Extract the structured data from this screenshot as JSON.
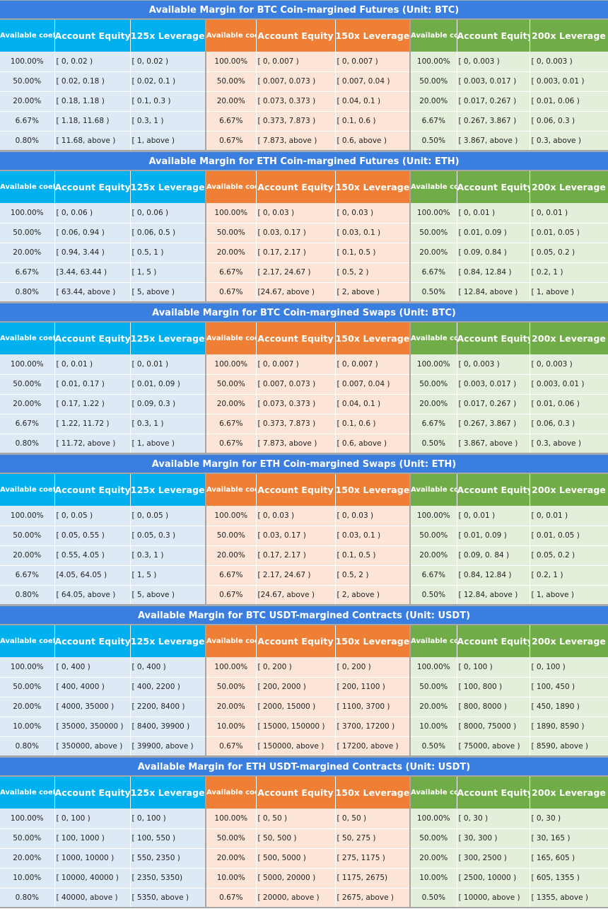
{
  "colors": {
    "title_bg": "#3a7ee0",
    "group_125x": "#00b0ef",
    "group_150x": "#ef7f34",
    "group_200x": "#70ac47",
    "row_125x": "#dde9f5",
    "row_150x": "#fce4d6",
    "row_200x": "#e3efda"
  },
  "headers": {
    "coefficient": "Available coefficient",
    "equity": "Account Equity",
    "lev125": "125x Leverage",
    "lev150": "150x Leverage",
    "lev200": "200x Leverage"
  },
  "tables": [
    {
      "title": "Available Margin for BTC Coin-margined Futures (Unit: BTC)",
      "rows": [
        [
          "100.00%",
          "[ 0, 0.02 )",
          "[ 0, 0.02 )",
          "100.00%",
          "[ 0, 0.007 )",
          "[ 0, 0.007 )",
          "100.00%",
          "[ 0, 0.003 )",
          "[ 0, 0.003 )"
        ],
        [
          "50.00%",
          "[ 0.02, 0.18 )",
          "[ 0.02, 0.1 )",
          "50.00%",
          "[ 0.007, 0.073 )",
          "[ 0.007, 0.04 )",
          "50.00%",
          "[ 0.003, 0.017 )",
          "[ 0.003, 0.01 )"
        ],
        [
          "20.00%",
          "[ 0.18, 1.18 )",
          "[ 0.1, 0.3 )",
          "20.00%",
          "[ 0.073,  0.373 )",
          "[ 0.04, 0.1 )",
          "20.00%",
          "[ 0.017, 0.267 )",
          "[ 0.01, 0.06 )"
        ],
        [
          "6.67%",
          "[ 1.18, 11.68 )",
          "[ 0.3, 1 )",
          "6.67%",
          "[ 0.373, 7.873 )",
          "[ 0.1, 0.6 )",
          "6.67%",
          "[ 0.267, 3.867 )",
          "[ 0.06, 0.3 )"
        ],
        [
          "0.80%",
          "[ 11.68, above )",
          "[ 1, above )",
          "0.67%",
          "[ 7.873, above )",
          "[ 0.6, above )",
          "0.50%",
          "[ 3.867, above )",
          "[ 0.3, above )"
        ]
      ]
    },
    {
      "title": "Available Margin for ETH Coin-margined Futures (Unit: ETH)",
      "rows": [
        [
          "100.00%",
          "[ 0, 0.06 )",
          "[ 0, 0.06 )",
          "100.00%",
          "[ 0, 0.03 )",
          "[ 0, 0.03 )",
          "100.00%",
          "[ 0, 0.01 )",
          "[ 0, 0.01 )"
        ],
        [
          "50.00%",
          "[ 0.06, 0.94 )",
          "[ 0.06, 0.5 )",
          "50.00%",
          "[ 0.03, 0.17 )",
          "[ 0.03, 0.1 )",
          "50.00%",
          "[ 0.01, 0.09 )",
          "[ 0.01, 0.05 )"
        ],
        [
          "20.00%",
          "[ 0.94, 3.44 )",
          "[ 0.5, 1 )",
          "20.00%",
          "[ 0.17, 2.17 )",
          "[ 0.1, 0.5 )",
          "20.00%",
          "[ 0.09, 0.84 )",
          "[ 0.05, 0.2 )"
        ],
        [
          "6.67%",
          "[3.44, 63.44 )",
          "[ 1, 5 )",
          "6.67%",
          "[ 2.17, 24.67 )",
          "[ 0.5, 2 )",
          "6.67%",
          "[ 0.84, 12.84 )",
          "[ 0.2, 1 )"
        ],
        [
          "0.80%",
          "[ 63.44, above )",
          "[ 5, above )",
          "0.67%",
          "[24.67, above )",
          "[ 2, above )",
          "0.50%",
          "[ 12.84, above )",
          "[ 1, above )"
        ]
      ]
    },
    {
      "title": "Available Margin for BTC Coin-margined Swaps (Unit: BTC)",
      "rows": [
        [
          "100.00%",
          "[ 0, 0.01 )",
          "[ 0, 0.01 )",
          "100.00%",
          "[ 0, 0.007 )",
          "[ 0, 0.007 )",
          "100.00%",
          "[ 0, 0.003 )",
          "[ 0, 0.003 )"
        ],
        [
          "50.00%",
          "[ 0.01, 0.17 )",
          "[ 0.01, 0.09 )",
          "50.00%",
          "[ 0.007, 0.073 )",
          "[ 0.007, 0.04 )",
          "50.00%",
          "[ 0.003, 0.017 )",
          "[ 0.003, 0.01 )"
        ],
        [
          "20.00%",
          "[ 0.17, 1.22 )",
          "[ 0.09, 0.3 )",
          "20.00%",
          "[ 0.073,  0.373 )",
          "[ 0.04, 0.1 )",
          "20.00%",
          "[ 0.017, 0.267 )",
          "[ 0.01, 0.06 )"
        ],
        [
          "6.67%",
          "[ 1.22, 11.72 )",
          "[ 0.3, 1 )",
          "6.67%",
          "[ 0.373, 7.873 )",
          "[ 0.1, 0.6 )",
          "6.67%",
          "[ 0.267, 3.867 )",
          "[ 0.06, 0.3 )"
        ],
        [
          "0.80%",
          "[ 11.72, above )",
          "[ 1, above )",
          "0.67%",
          "[ 7.873, above )",
          "[ 0.6, above )",
          "0.50%",
          "[ 3.867, above )",
          "[ 0.3, above )"
        ]
      ]
    },
    {
      "title": "Available Margin for ETH Coin-margined Swaps (Unit: ETH)",
      "rows": [
        [
          "100.00%",
          "[ 0, 0.05 )",
          "[ 0, 0.05 )",
          "100.00%",
          "[ 0, 0.03 )",
          "[ 0, 0.03 )",
          "100.00%",
          "[ 0, 0.01 )",
          "[ 0, 0.01 )"
        ],
        [
          "50.00%",
          "[ 0.05, 0.55 )",
          "[ 0.05, 0.3 )",
          "50.00%",
          "[ 0.03, 0.17 )",
          "[ 0.03, 0.1 )",
          "50.00%",
          "[ 0.01, 0.09 )",
          "[ 0.01, 0.05 )"
        ],
        [
          "20.00%",
          "[ 0.55, 4.05 )",
          "[ 0.3, 1 )",
          "20.00%",
          "[ 0.17, 2.17 )",
          "[ 0.1, 0.5 )",
          "20.00%",
          "[ 0.09, 0. 84 )",
          "[ 0.05, 0.2 )"
        ],
        [
          "6.67%",
          "[4.05, 64.05 )",
          "[ 1, 5 )",
          "6.67%",
          "[ 2.17, 24.67 )",
          "[ 0.5, 2 )",
          "6.67%",
          "[ 0.84, 12.84 )",
          "[ 0.2, 1 )"
        ],
        [
          "0.80%",
          "[ 64.05, above )",
          "[ 5, above )",
          "0.67%",
          "[24.67, above )",
          "[ 2, above )",
          "0.50%",
          "[ 12.84, above )",
          "[ 1, above )"
        ]
      ]
    },
    {
      "title": "Available Margin for BTC USDT-margined Contracts (Unit: USDT)",
      "rows": [
        [
          "100.00%",
          "[ 0, 400 )",
          "[ 0, 400 )",
          "100.00%",
          "[ 0, 200 )",
          "[ 0, 200 )",
          "100.00%",
          "[ 0, 100 )",
          "[ 0, 100 )"
        ],
        [
          "50.00%",
          "[ 400, 4000 )",
          "[ 400, 2200 )",
          "50.00%",
          "[ 200, 2000 )",
          "[ 200, 1100 )",
          "50.00%",
          "[ 100, 800 )",
          "[ 100, 450 )"
        ],
        [
          "20.00%",
          "[ 4000, 35000 )",
          "[ 2200, 8400 )",
          "20.00%",
          "[ 2000,  15000 )",
          "[ 1100, 3700 )",
          "20.00%",
          "[ 800, 8000 )",
          "[ 450, 1890 )"
        ],
        [
          "10.00%",
          "[ 35000, 350000 )",
          "[ 8400, 39900 )",
          "10.00%",
          "[ 15000, 150000 )",
          "[ 3700, 17200 )",
          "10.00%",
          "[ 8000, 75000 )",
          "[ 1890, 8590 )"
        ],
        [
          "0.80%",
          "[ 350000, above )",
          "[ 39900, above )",
          "0.67%",
          "[ 150000, above )",
          "[ 17200, above )",
          "0.50%",
          "[ 75000, above )",
          "[ 8590, above )"
        ]
      ]
    },
    {
      "title": "Available Margin for ETH USDT-margined Contracts (Unit: USDT)",
      "rows": [
        [
          "100.00%",
          "[ 0, 100 )",
          "[ 0, 100 )",
          "100.00%",
          "[ 0, 50 )",
          "[ 0, 50 )",
          "100.00%",
          "[ 0, 30 )",
          "[ 0, 30 )"
        ],
        [
          "50.00%",
          "[ 100, 1000 )",
          "[ 100, 550 )",
          "50.00%",
          "[ 50, 500 )",
          "[ 50, 275 )",
          "50.00%",
          "[ 30, 300 )",
          "[ 30, 165 )"
        ],
        [
          "20.00%",
          "[ 1000, 10000 )",
          "[ 550, 2350 )",
          "20.00%",
          "[ 500, 5000 )",
          "[ 275, 1175 )",
          "20.00%",
          "[ 300, 2500 )",
          "[ 165, 605 )"
        ],
        [
          "10.00%",
          "[ 10000, 40000 )",
          "[ 2350,  5350)",
          "10.00%",
          "[ 5000, 20000 )",
          "[ 1175,  2675)",
          "10.00%",
          "[ 2500, 10000 )",
          "[ 605, 1355 )"
        ],
        [
          "0.80%",
          "[ 40000, above )",
          "[ 5350, above )",
          "0.67%",
          "[ 20000, above )",
          "[ 2675, above )",
          "0.50%",
          "[ 10000, above )",
          "[ 1355, above )"
        ]
      ]
    }
  ]
}
